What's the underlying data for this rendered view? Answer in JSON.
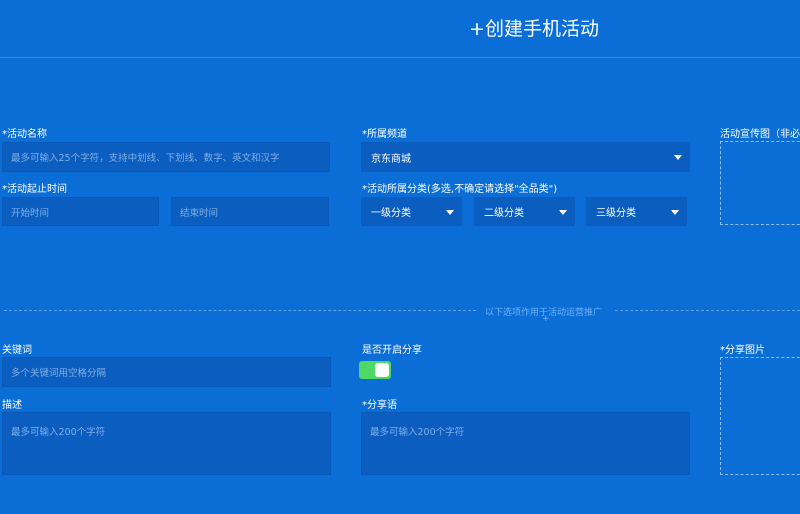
{
  "page": {
    "title": "+创建手机活动"
  },
  "form": {
    "name": {
      "label": "*活动名称",
      "placeholder": "最多可输入25个字符，支持中划线、下划线、数字、英文和汉字"
    },
    "channel": {
      "label": "*所属频道",
      "value": "京东商城"
    },
    "poster": {
      "label": "活动宣传图（非必填"
    },
    "period": {
      "label": "*活动起止时间",
      "start_placeholder": "开始时间",
      "end_placeholder": "结束时间"
    },
    "category": {
      "label": "*活动所属分类(多选,不确定请选择\"全品类\")",
      "level1": "一级分类",
      "level2": "二级分类",
      "level3": "三级分类"
    }
  },
  "divider": {
    "text": "以下选项作用于活动运营推广",
    "plus": "+"
  },
  "promo": {
    "keywords": {
      "label": "关键词",
      "placeholder": "多个关键词用空格分隔"
    },
    "share_toggle": {
      "label": "是否开启分享",
      "on": true
    },
    "share_image": {
      "label": "*分享图片"
    },
    "description": {
      "label": "描述",
      "placeholder": "最多可输入200个字符"
    },
    "share_text": {
      "label": "*分享语",
      "placeholder": "最多可输入200个字符"
    }
  },
  "colors": {
    "background": "#0a6ed6",
    "input": "#0b5dc0",
    "toggle_on": "#4cd964"
  }
}
